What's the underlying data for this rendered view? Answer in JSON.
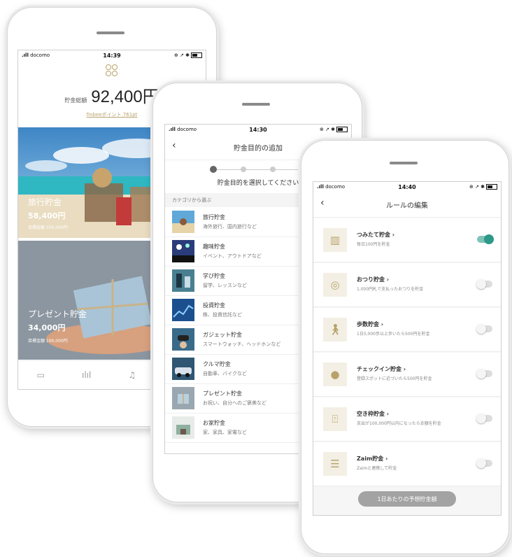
{
  "phone1": {
    "status": {
      "carrier": "docomo",
      "time": "14:39"
    },
    "savings_label": "貯金総額",
    "savings_amount": "92,400円",
    "points_link": "finbeeポイント 761pt",
    "cards": [
      {
        "title": "旅行貯金",
        "amount": "58,400円",
        "goal": "目標金額 100,000円"
      },
      {
        "title": "プレゼント貯金",
        "amount": "34,000円",
        "goal": "目標金額 100,000円"
      }
    ],
    "tabs": [
      "home-icon",
      "chart-icon",
      "bell-icon"
    ]
  },
  "phone2": {
    "status": {
      "carrier": "docomo",
      "time": "14:30"
    },
    "title": "貯金目的の追加",
    "prompt": "貯金目的を選択してください",
    "section": "カテゴリから選ぶ",
    "categories": [
      {
        "name": "旅行貯金",
        "desc": "海外旅行、国内旅行など"
      },
      {
        "name": "趣味貯金",
        "desc": "イベント、アウトドアなど"
      },
      {
        "name": "学び貯金",
        "desc": "留学、レッスンなど"
      },
      {
        "name": "投資貯金",
        "desc": "株、投資信託など"
      },
      {
        "name": "ガジェット貯金",
        "desc": "スマートウォッチ、ヘッドホンなど"
      },
      {
        "name": "クルマ貯金",
        "desc": "自動車、バイクなど"
      },
      {
        "name": "プレゼント貯金",
        "desc": "お祝い、自分へのご褒美など"
      },
      {
        "name": "お家貯金",
        "desc": "家、家具、家電など"
      }
    ]
  },
  "phone3": {
    "status": {
      "carrier": "docomo",
      "time": "14:40"
    },
    "title": "ルールの編集",
    "rules": [
      {
        "name": "つみたて貯金 ›",
        "desc": "毎日100円を貯金",
        "icon": "piggy-icon",
        "on": true
      },
      {
        "name": "おつり貯金 ›",
        "desc": "1,000円札で支払ったおつりを貯金",
        "icon": "coin-icon",
        "on": false
      },
      {
        "name": "歩数貯金 ›",
        "desc": "1日5,000歩以上歩いたら500円を貯金",
        "icon": "walk-icon",
        "on": false
      },
      {
        "name": "チェックイン貯金 ›",
        "desc": "登録スポットに近づいたら500円を貯金",
        "icon": "pin-icon",
        "on": false
      },
      {
        "name": "空き枠貯金 ›",
        "desc": "支出が100,000円以内になったら余額を貯金",
        "icon": "frame-icon",
        "on": false
      },
      {
        "name": "Zaim貯金 ›",
        "desc": "Zaimと連携して貯金",
        "icon": "stack-icon",
        "on": false
      }
    ],
    "footer_button": "1日あたりの予想貯金額"
  },
  "colors": {
    "accent": "#b8a26a",
    "toggle_on": "#2e9889"
  }
}
